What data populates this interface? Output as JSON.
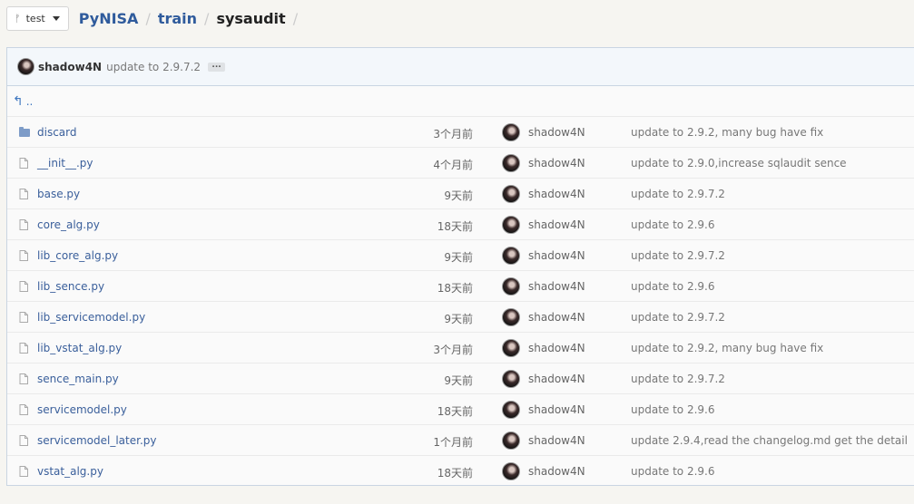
{
  "branch": {
    "label": "test"
  },
  "breadcrumb": {
    "repo": "PyNISA",
    "dir": "train",
    "current": "sysaudit",
    "separator": "/"
  },
  "latest_commit": {
    "author": "shadow4N",
    "message": "update to 2.9.7.2",
    "more": "..."
  },
  "parent_link": {
    "label": ".."
  },
  "files": [
    {
      "type": "dir",
      "name": "discard",
      "age": "3个月前",
      "author": "shadow4N",
      "message": "update to 2.9.2, many bug have fix"
    },
    {
      "type": "file",
      "name": "__init__.py",
      "age": "4个月前",
      "author": "shadow4N",
      "message": "update to 2.9.0,increase sqlaudit sence"
    },
    {
      "type": "file",
      "name": "base.py",
      "age": "9天前",
      "author": "shadow4N",
      "message": "update to 2.9.7.2"
    },
    {
      "type": "file",
      "name": "core_alg.py",
      "age": "18天前",
      "author": "shadow4N",
      "message": "update to 2.9.6"
    },
    {
      "type": "file",
      "name": "lib_core_alg.py",
      "age": "9天前",
      "author": "shadow4N",
      "message": "update to 2.9.7.2"
    },
    {
      "type": "file",
      "name": "lib_sence.py",
      "age": "18天前",
      "author": "shadow4N",
      "message": "update to 2.9.6"
    },
    {
      "type": "file",
      "name": "lib_servicemodel.py",
      "age": "9天前",
      "author": "shadow4N",
      "message": "update to 2.9.7.2"
    },
    {
      "type": "file",
      "name": "lib_vstat_alg.py",
      "age": "3个月前",
      "author": "shadow4N",
      "message": "update to 2.9.2, many bug have fix"
    },
    {
      "type": "file",
      "name": "sence_main.py",
      "age": "9天前",
      "author": "shadow4N",
      "message": "update to 2.9.7.2"
    },
    {
      "type": "file",
      "name": "servicemodel.py",
      "age": "18天前",
      "author": "shadow4N",
      "message": "update to 2.9.6"
    },
    {
      "type": "file",
      "name": "servicemodel_later.py",
      "age": "1个月前",
      "author": "shadow4N",
      "message": "update 2.9.4,read the changelog.md get the detail"
    },
    {
      "type": "file",
      "name": "vstat_alg.py",
      "age": "18天前",
      "author": "shadow4N",
      "message": "update to 2.9.6"
    }
  ],
  "icons": {
    "branch": "branch-icon",
    "folder": "folder-icon",
    "file": "file-icon",
    "up": "up-arrow-icon",
    "avatar": "avatar"
  },
  "colors": {
    "link": "#3a5f9b",
    "breadcrumb": "#2f5b9c",
    "commit_bar_bg": "#f3f7fb",
    "border": "#c9d5e2",
    "page_bg": "#f6f5f1"
  }
}
